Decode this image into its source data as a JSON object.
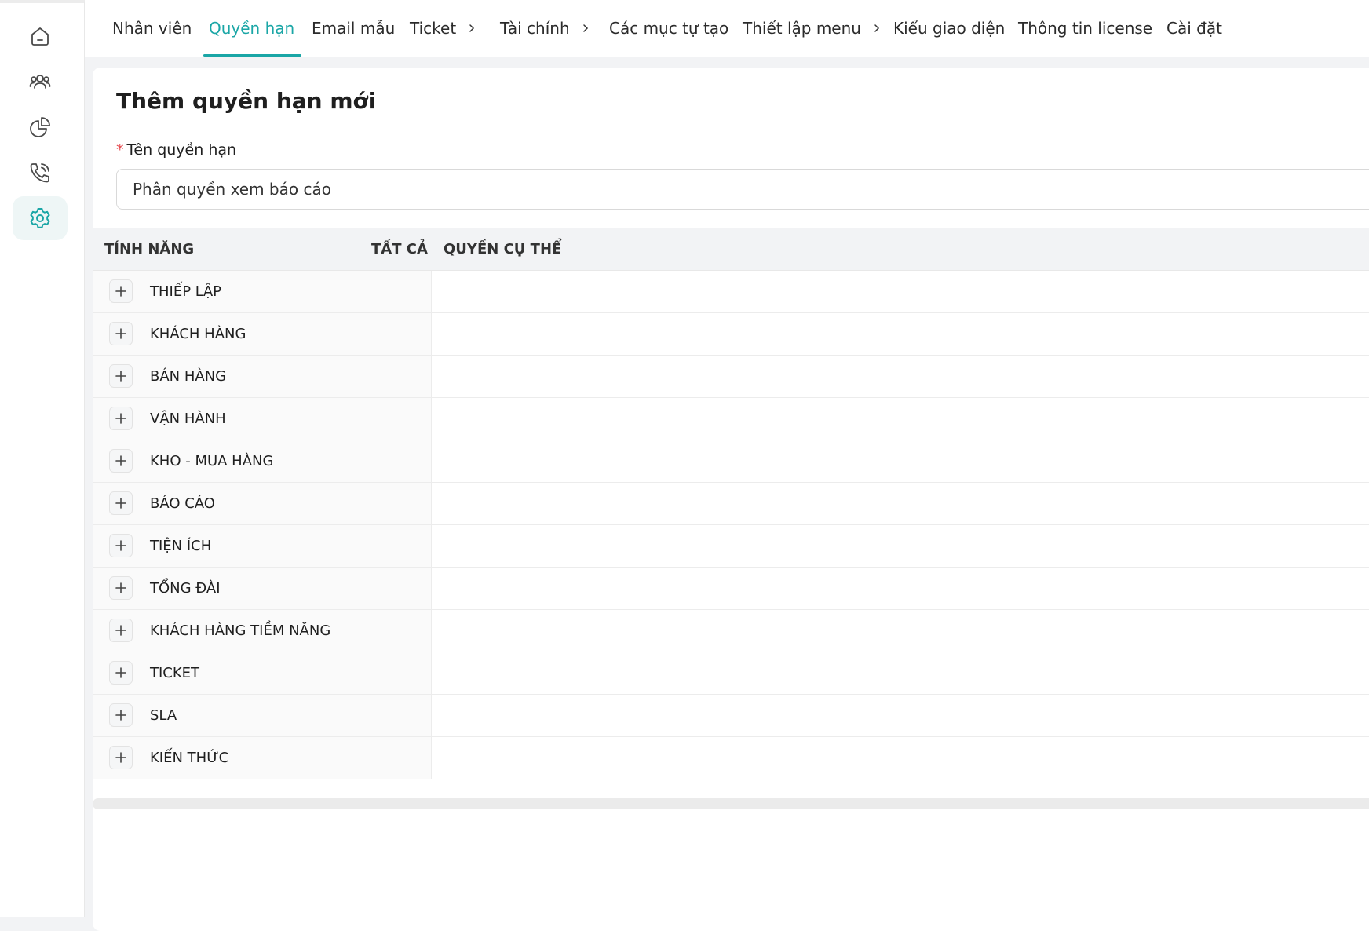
{
  "colors": {
    "accent": "#1aa6a6",
    "required": "#e5484d"
  },
  "sidebar": {
    "items": [
      {
        "icon": "home-icon",
        "active": false
      },
      {
        "icon": "users-icon",
        "active": false
      },
      {
        "icon": "pie-chart-icon",
        "active": false
      },
      {
        "icon": "phone-call-icon",
        "active": false
      },
      {
        "icon": "gear-icon",
        "active": true
      }
    ]
  },
  "tabs": [
    {
      "label": "Nhân viên"
    },
    {
      "label": "Quyền hạn",
      "active": true
    },
    {
      "label": "Email mẫu"
    },
    {
      "label": "Ticket",
      "has_submenu": true
    },
    {
      "label": "Tài chính",
      "has_submenu": true
    },
    {
      "label": "Các mục tự tạo"
    },
    {
      "label": "Thiết lập menu",
      "has_submenu": true
    },
    {
      "label": "Kiểu giao diện"
    },
    {
      "label": "Thông tin license"
    },
    {
      "label": "Cài đặt"
    }
  ],
  "form": {
    "title": "Thêm quyền hạn mới",
    "name_label": "Tên quyền hạn",
    "required_mark": "*",
    "name_value": "Phân quyền xem báo cáo"
  },
  "table": {
    "headers": {
      "feature": "TÍNH NĂNG",
      "all": "TẤT CẢ",
      "specific": "QUYỀN CỤ THỂ"
    },
    "rows": [
      {
        "label": "THIẾP LẬP"
      },
      {
        "label": "KHÁCH HÀNG"
      },
      {
        "label": "BÁN HÀNG"
      },
      {
        "label": "VẬN HÀNH"
      },
      {
        "label": "KHO - MUA HÀNG"
      },
      {
        "label": "BÁO CÁO"
      },
      {
        "label": "TIỆN ÍCH"
      },
      {
        "label": "TỔNG ĐÀI"
      },
      {
        "label": "KHÁCH HÀNG TIỀM NĂNG"
      },
      {
        "label": "TICKET"
      },
      {
        "label": "SLA"
      },
      {
        "label": "KIẾN THỨC"
      }
    ]
  }
}
